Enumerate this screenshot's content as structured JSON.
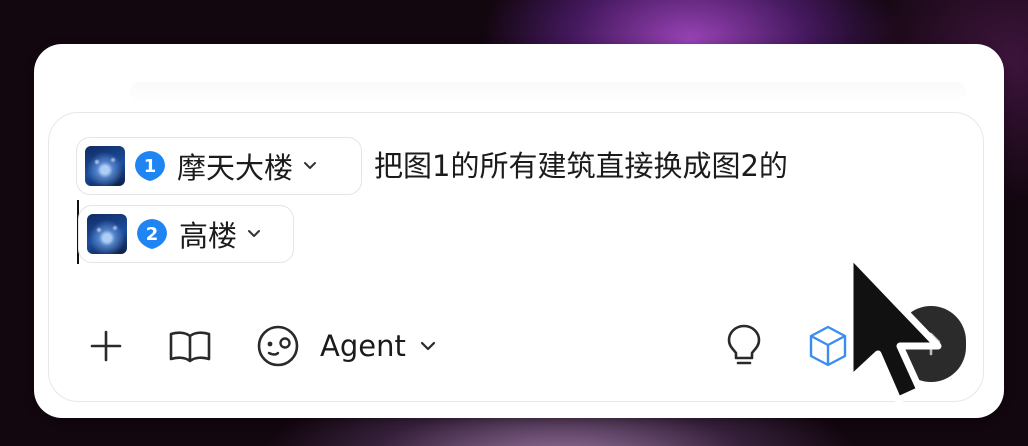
{
  "composer": {
    "mentions": [
      {
        "number": "1",
        "label": "摩天大楼"
      },
      {
        "number": "2",
        "label": "高楼"
      }
    ],
    "prompt_text": "把图1的所有建筑直接换成图2的"
  },
  "toolbar": {
    "plus_icon": "plus-icon",
    "book_icon": "book-open-icon",
    "agent_label": "Agent",
    "agent_icon": "agent-face-icon",
    "bulb_icon": "lightbulb-icon",
    "cube_icon": "cube-icon",
    "send_icon": "arrow-up-icon"
  },
  "colors": {
    "badge_blue": "#1f85f2",
    "cube_blue": "#3b8ef0",
    "send_bg": "#2b2b2b"
  }
}
